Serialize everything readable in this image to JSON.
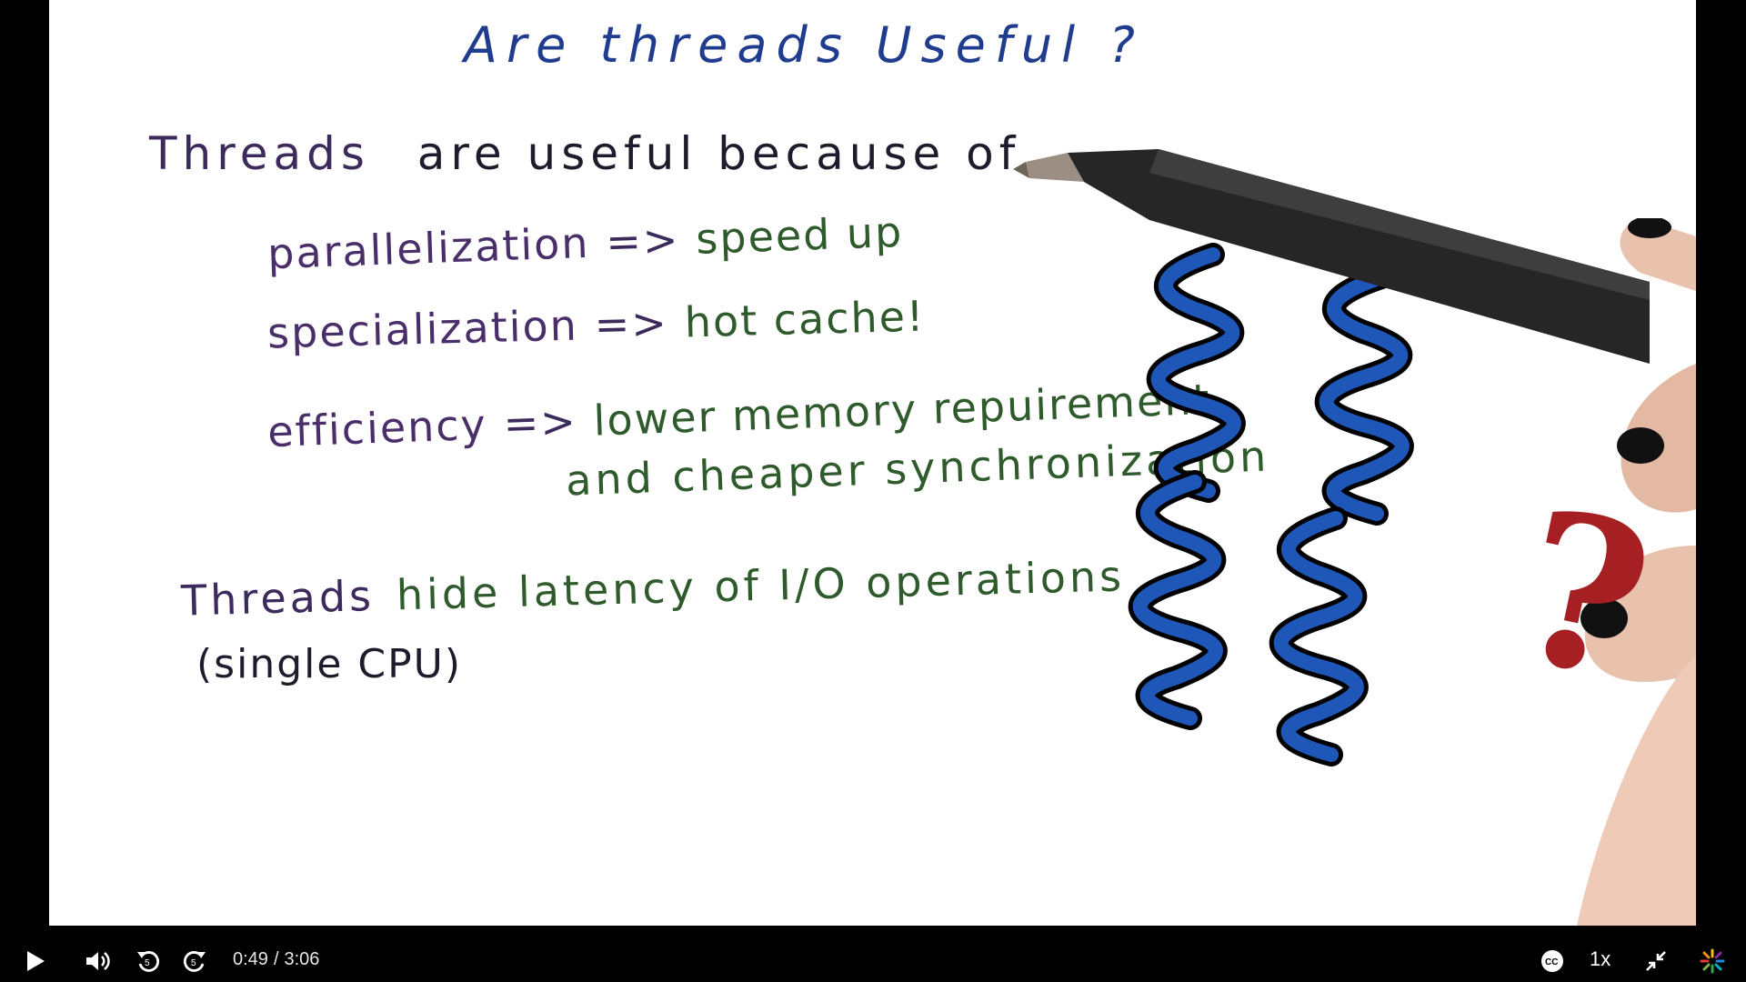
{
  "slide": {
    "title": "Are threads Useful ?",
    "heading1_first": "Threads",
    "heading1_rest": "are useful because of...",
    "items": [
      {
        "term": "parallelization",
        "arrow": "=>",
        "result": "speed up"
      },
      {
        "term": "specialization",
        "arrow": "=>",
        "result": "hot cache!"
      },
      {
        "term": "efficiency",
        "arrow": "=>",
        "result": "lower memory repuirement"
      }
    ],
    "item3_continuation": "and cheaper synchronization",
    "heading2_first": "Threads",
    "heading2_rest": "hide latency of I/O operations",
    "note": "(single CPU)",
    "question_mark": "?"
  },
  "player": {
    "current_time": "0:49",
    "separator": "/",
    "duration": "3:06",
    "progress": 0.269,
    "buffered": 0.64,
    "speed_label": "1x",
    "icons": {
      "play": "play-icon",
      "volume": "volume-icon",
      "rewind": "rewind-5-icon",
      "forward": "forward-5-icon",
      "captions": "closed-captions-icon",
      "exit_fullscreen": "exit-fullscreen-icon",
      "brand": "brand-logo-icon"
    },
    "colors": {
      "progress": "#1d9bd7",
      "buffered": "#5e5e5e",
      "track": "#3a3a3a"
    }
  }
}
